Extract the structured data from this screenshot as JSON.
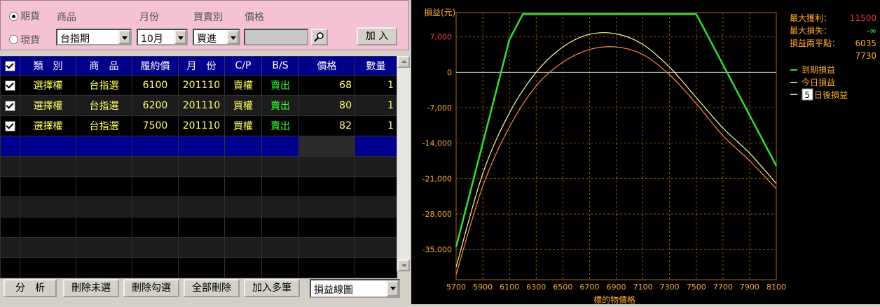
{
  "form": {
    "market_options": [
      {
        "label": "期貨",
        "selected": true
      },
      {
        "label": "現貨",
        "selected": false
      }
    ],
    "labels": {
      "product": "商品",
      "month": "月份",
      "buysell": "買賣別",
      "price": "價格"
    },
    "product_value": "台指期",
    "month_value": "10月",
    "buysell_value": "買進",
    "price_value": "",
    "add_button": "加 入"
  },
  "table": {
    "headers": [
      "類　別",
      "商　品",
      "履約價",
      "月　份",
      "C/P",
      "B/S",
      "價格",
      "數量"
    ],
    "rows": [
      {
        "type": "選擇權",
        "product": "台指選",
        "strike": "6100",
        "month": "201110",
        "cp": "賣權",
        "bs": "賣出",
        "price": "68",
        "qty": "1"
      },
      {
        "type": "選擇權",
        "product": "台指選",
        "strike": "6200",
        "month": "201110",
        "cp": "買權",
        "bs": "賣出",
        "price": "80",
        "qty": "1"
      },
      {
        "type": "選擇權",
        "product": "台指選",
        "strike": "7500",
        "month": "201110",
        "cp": "買權",
        "bs": "賣出",
        "price": "82",
        "qty": "1"
      }
    ]
  },
  "buttons": {
    "analyze": "分　析",
    "delete_unchecked": "刪除未選",
    "delete_checked": "刪除勾選",
    "delete_all": "全部刪除",
    "add_multi": "加入多筆",
    "view_select": "損益線圖"
  },
  "info": {
    "max_profit_label": "最大獲利：",
    "max_profit_value": "11500",
    "max_loss_label": "最大損失：",
    "max_loss_value": "-∞",
    "breakeven_label": "損益兩平點：",
    "breakeven_1": "6035",
    "breakeven_2": "7730"
  },
  "legend": {
    "expiry": "到期損益",
    "today": "今日損益",
    "days_value": "5",
    "days_suffix": "日後損益"
  },
  "colors": {
    "expiry": "#33dd33",
    "today": "#ffff99",
    "days": "#ff8844",
    "grid": "#a86a00",
    "axis_text": "#ffaa33"
  },
  "chart_data": {
    "type": "line",
    "ylabel": "損益(元)",
    "xlabel": "標的物價格",
    "x_ticks": [
      5700,
      5900,
      6100,
      6300,
      6500,
      6700,
      6900,
      7100,
      7300,
      7500,
      7700,
      7900,
      8100
    ],
    "y_ticks": [
      7000,
      0,
      -7000,
      -14000,
      -21000,
      -28000,
      -35000
    ],
    "y_tick_labels": [
      "7,000",
      "0",
      "-7,000",
      "-14,000",
      "-21,000",
      "-28,000",
      "-35,000"
    ],
    "xlim": [
      5700,
      8100
    ],
    "ylim": [
      -41000,
      11800
    ],
    "grid": true,
    "series": [
      {
        "name": "到期損益",
        "x": [
          5700,
          6100,
          6200,
          7500,
          8100
        ],
        "y": [
          -34500,
          6500,
          11500,
          11500,
          -18500
        ]
      },
      {
        "name": "今日損益",
        "x": [
          5700,
          5900,
          6100,
          6300,
          6500,
          6700,
          6900,
          7100,
          7300,
          7500,
          7700,
          7900,
          8100
        ],
        "y": [
          -38500,
          -20000,
          -8000,
          0,
          5000,
          7500,
          7600,
          5500,
          1000,
          -5000,
          -11000,
          -16000,
          -22000
        ]
      },
      {
        "name": "日後損益",
        "x": [
          5700,
          5900,
          6100,
          6300,
          6500,
          6700,
          6900,
          7100,
          7300,
          7500,
          7700,
          7900,
          8100
        ],
        "y": [
          -40000,
          -22500,
          -10800,
          -2700,
          2000,
          4500,
          5000,
          3500,
          -500,
          -6200,
          -12500,
          -17500,
          -23000
        ]
      }
    ]
  }
}
